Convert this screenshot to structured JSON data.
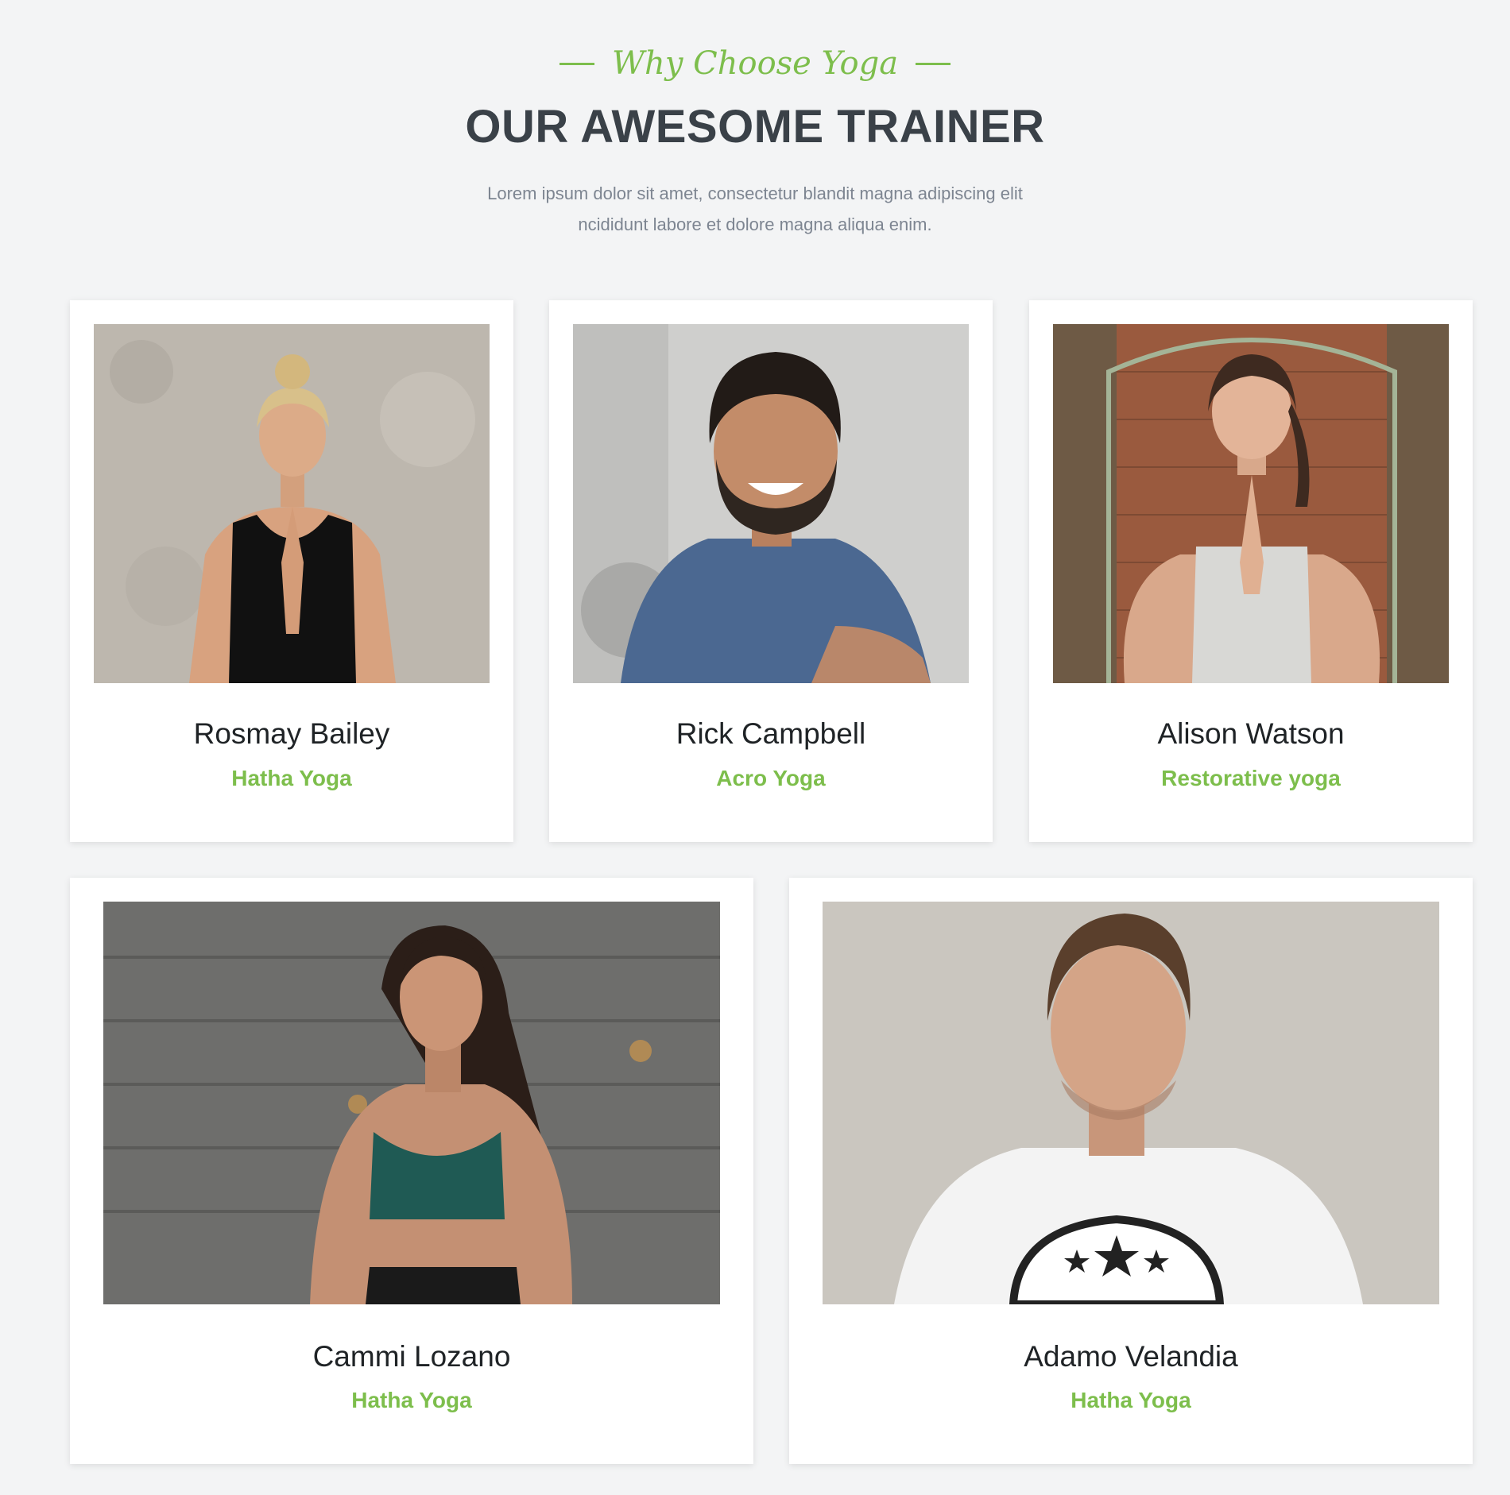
{
  "header": {
    "eyebrow": "Why Choose Yoga",
    "title": "OUR AWESOME TRAINER",
    "description_line1": "Lorem ipsum dolor sit amet, consectetur blandit magna adipiscing elit",
    "description_line2": "ncididunt labore et dolore magna aliqua enim."
  },
  "colors": {
    "accent": "#7dbe4c",
    "title": "#3a4148",
    "background": "#f3f4f5",
    "card": "#ffffff"
  },
  "trainers": [
    {
      "name": "Rosmay Bailey",
      "specialty": "Hatha Yoga"
    },
    {
      "name": "Rick Campbell",
      "specialty": "Acro Yoga"
    },
    {
      "name": "Alison Watson",
      "specialty": "Restorative yoga"
    },
    {
      "name": "Cammi Lozano",
      "specialty": "Hatha Yoga"
    },
    {
      "name": "Adamo Velandia",
      "specialty": "Hatha Yoga"
    }
  ]
}
